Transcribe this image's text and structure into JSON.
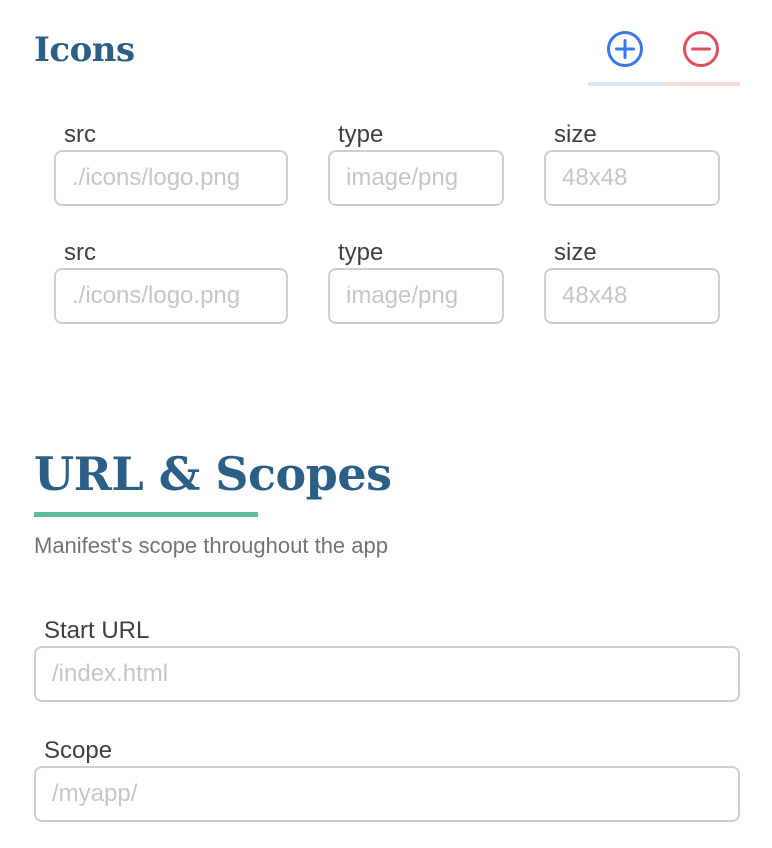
{
  "icons_section": {
    "title": "Icons",
    "add_icon": "plus-circle-icon",
    "remove_icon": "minus-circle-icon",
    "add_color": "#3b78e7",
    "remove_color": "#e0505c",
    "rows": [
      {
        "src_label": "src",
        "src_placeholder": "./icons/logo.png",
        "type_label": "type",
        "type_placeholder": "image/png",
        "size_label": "size",
        "size_placeholder": "48x48"
      },
      {
        "src_label": "src",
        "src_placeholder": "./icons/logo.png",
        "type_label": "type",
        "type_placeholder": "image/png",
        "size_label": "size",
        "size_placeholder": "48x48"
      }
    ]
  },
  "url_section": {
    "title": "URL & Scopes",
    "subtitle": "Manifest's scope throughout the app",
    "accent_color": "#5bbd9a",
    "start_url_label": "Start URL",
    "start_url_placeholder": "/index.html",
    "scope_label": "Scope",
    "scope_placeholder": "/myapp/"
  }
}
